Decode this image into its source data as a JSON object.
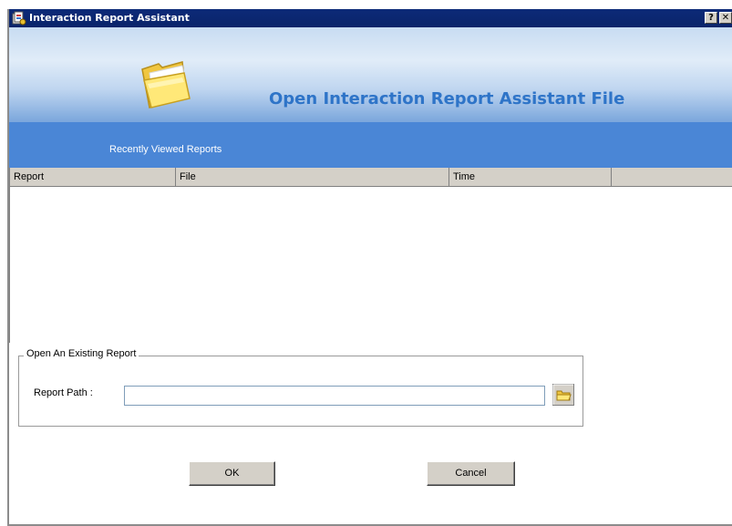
{
  "window": {
    "title": "Interaction Report Assistant",
    "help_label": "?",
    "close_label": "✕"
  },
  "header": {
    "title": "Open Interaction Report Assistant File",
    "icon": "folder-icon",
    "title_color": "#2e74c8"
  },
  "recent": {
    "section_label": "Recently Viewed Reports",
    "bar_color": "#4a86d6",
    "columns": [
      "Report",
      "File",
      "Time",
      ""
    ],
    "rows": []
  },
  "open_existing": {
    "group_label": "Open An Existing Report",
    "path_label": "Report Path :",
    "path_value": "",
    "browse_icon": "folder-icon"
  },
  "buttons": {
    "ok": "OK",
    "cancel": "Cancel"
  }
}
